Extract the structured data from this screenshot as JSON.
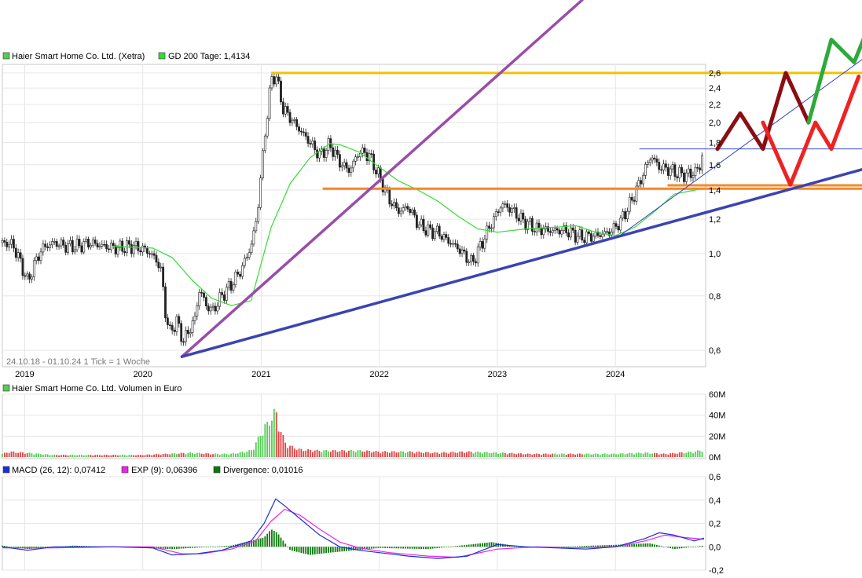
{
  "colors": {
    "price": "#222222",
    "gd200": "#33dd33",
    "yellow": "#f2c200",
    "orange": "#f28a2a",
    "purple": "#9a4da8",
    "blue": "#3b44b0",
    "thinblue": "#3344cc",
    "darkred": "#8b0e12",
    "red": "#ee2222",
    "green": "#2daa3a",
    "vol_up": "#55cc55",
    "vol_down": "#dd4444",
    "macd": "#1a2fd6",
    "exp": "#ee22ee",
    "div": "#0a7a0a",
    "grid": "#e6e6e6"
  },
  "legend": {
    "price": "Haier Smart Home Co. Ltd. (Xetra)",
    "gd200": "GD 200 Tage: 1,4134",
    "volume": "Haier Smart Home Co. Ltd. Volumen in Euro",
    "macd": "MACD (26, 12): 0,07412",
    "exp": "EXP (9): 0,06396",
    "divergence": "Divergence: 0,01016"
  },
  "info": "24.10.18 - 01.10.24   1 Tick = 1 Woche",
  "chart_data": [
    {
      "type": "line",
      "title": "",
      "x_ticks": [
        "2019",
        "2020",
        "2021",
        "2022",
        "2023",
        "2024"
      ],
      "y_scale": "log",
      "ylim": [
        0.55,
        2.72
      ],
      "y_ticks": [
        "0,6",
        "0,8",
        "1,0",
        "1,2",
        "1,4",
        "1,6",
        "1,8",
        "2,0",
        "2,2",
        "2,4",
        "2,6"
      ],
      "x_range": [
        "2018-10-24",
        "2024-10-01"
      ],
      "series": [
        {
          "name": "Haier Smart Home Co. Ltd. (Xetra)",
          "points": [
            [
              "2018-10-24",
              1.06
            ],
            [
              "2018-11-25",
              1.05
            ],
            [
              "2018-12-20",
              0.95
            ],
            [
              "2019-01-10",
              0.86
            ],
            [
              "2019-02-01",
              0.95
            ],
            [
              "2019-02-25",
              1.03
            ],
            [
              "2019-04-01",
              1.06
            ],
            [
              "2019-05-10",
              1.04
            ],
            [
              "2019-06-15",
              1.04
            ],
            [
              "2019-07-20",
              1.06
            ],
            [
              "2019-09-01",
              1.04
            ],
            [
              "2019-10-15",
              1.03
            ],
            [
              "2019-12-01",
              1.04
            ],
            [
              "2020-01-10",
              1.02
            ],
            [
              "2020-02-01",
              0.99
            ],
            [
              "2020-02-25",
              0.93
            ],
            [
              "2020-03-12",
              0.72
            ],
            [
              "2020-03-25",
              0.66
            ],
            [
              "2020-04-15",
              0.7
            ],
            [
              "2020-05-05",
              0.63
            ],
            [
              "2020-05-25",
              0.67
            ],
            [
              "2020-06-10",
              0.71
            ],
            [
              "2020-06-25",
              0.83
            ],
            [
              "2020-07-15",
              0.76
            ],
            [
              "2020-08-05",
              0.74
            ],
            [
              "2020-09-01",
              0.8
            ],
            [
              "2020-10-01",
              0.85
            ],
            [
              "2020-11-01",
              0.92
            ],
            [
              "2020-12-01",
              1.04
            ],
            [
              "2020-12-20",
              1.22
            ],
            [
              "2021-01-05",
              1.65
            ],
            [
              "2021-01-20",
              2.1
            ],
            [
              "2021-02-01",
              2.5
            ],
            [
              "2021-02-15",
              2.58
            ],
            [
              "2021-02-25",
              2.38
            ],
            [
              "2021-03-10",
              2.15
            ],
            [
              "2021-04-01",
              2.05
            ],
            [
              "2021-05-01",
              1.92
            ],
            [
              "2021-06-01",
              1.8
            ],
            [
              "2021-07-01",
              1.68
            ],
            [
              "2021-08-01",
              1.78
            ],
            [
              "2021-09-01",
              1.62
            ],
            [
              "2021-10-01",
              1.55
            ],
            [
              "2021-11-01",
              1.72
            ],
            [
              "2021-12-01",
              1.68
            ],
            [
              "2022-01-01",
              1.5
            ],
            [
              "2022-02-01",
              1.33
            ],
            [
              "2022-03-01",
              1.25
            ],
            [
              "2022-04-01",
              1.28
            ],
            [
              "2022-05-01",
              1.17
            ],
            [
              "2022-06-01",
              1.13
            ],
            [
              "2022-07-01",
              1.12
            ],
            [
              "2022-08-01",
              1.07
            ],
            [
              "2022-09-01",
              1.03
            ],
            [
              "2022-10-15",
              0.95
            ],
            [
              "2022-11-15",
              1.06
            ],
            [
              "2022-12-15",
              1.18
            ],
            [
              "2023-01-15",
              1.3
            ],
            [
              "2023-02-15",
              1.26
            ],
            [
              "2023-03-15",
              1.2
            ],
            [
              "2023-05-01",
              1.14
            ],
            [
              "2023-06-15",
              1.13
            ],
            [
              "2023-08-01",
              1.13
            ],
            [
              "2023-09-15",
              1.09
            ],
            [
              "2023-11-01",
              1.1
            ],
            [
              "2023-12-15",
              1.12
            ],
            [
              "2024-01-15",
              1.18
            ],
            [
              "2024-02-15",
              1.3
            ],
            [
              "2024-03-15",
              1.45
            ],
            [
              "2024-04-20",
              1.68
            ],
            [
              "2024-05-15",
              1.58
            ],
            [
              "2024-06-15",
              1.56
            ],
            [
              "2024-07-20",
              1.52
            ],
            [
              "2024-08-20",
              1.52
            ],
            [
              "2024-09-20",
              1.58
            ],
            [
              "2024-10-01",
              1.82
            ]
          ]
        },
        {
          "name": "GD 200 Tage",
          "points": [
            [
              "2019-10-01",
              1.04
            ],
            [
              "2020-02-01",
              1.03
            ],
            [
              "2020-04-01",
              0.98
            ],
            [
              "2020-06-01",
              0.87
            ],
            [
              "2020-08-01",
              0.79
            ],
            [
              "2020-10-01",
              0.76
            ],
            [
              "2020-12-01",
              0.78
            ],
            [
              "2021-01-01",
              0.95
            ],
            [
              "2021-02-01",
              1.15
            ],
            [
              "2021-04-01",
              1.45
            ],
            [
              "2021-06-01",
              1.66
            ],
            [
              "2021-08-01",
              1.79
            ],
            [
              "2021-09-01",
              1.78
            ],
            [
              "2021-11-01",
              1.71
            ],
            [
              "2022-01-01",
              1.58
            ],
            [
              "2022-03-01",
              1.47
            ],
            [
              "2022-05-01",
              1.4
            ],
            [
              "2022-07-01",
              1.32
            ],
            [
              "2022-09-01",
              1.22
            ],
            [
              "2022-11-01",
              1.14
            ],
            [
              "2023-01-01",
              1.12
            ],
            [
              "2023-04-01",
              1.14
            ],
            [
              "2023-07-01",
              1.15
            ],
            [
              "2023-09-01",
              1.16
            ],
            [
              "2023-11-01",
              1.12
            ],
            [
              "2024-01-01",
              1.1
            ],
            [
              "2024-03-01",
              1.15
            ],
            [
              "2024-05-01",
              1.25
            ],
            [
              "2024-07-01",
              1.37
            ],
            [
              "2024-10-01",
              1.4134
            ]
          ]
        }
      ],
      "annotations": {
        "hlines": [
          {
            "color": "yellow",
            "y": 2.6,
            "from": "2021-02-01",
            "to": "right"
          },
          {
            "color": "orange",
            "y": 1.41,
            "from": "2021-07-10",
            "to": "right"
          },
          {
            "color": "orange",
            "y": 1.435,
            "from": "2024-06-10",
            "to": "right"
          },
          {
            "color": "thinblue",
            "y": 1.74,
            "from": "2024-03-15",
            "to": "right"
          }
        ],
        "trendlines": [
          {
            "color": "purple",
            "from": [
              "2020-05-01",
              0.58
            ],
            "to": [
              "2022-06-01",
              1.85
            ]
          },
          {
            "color": "blue",
            "from": [
              "2020-05-01",
              0.58
            ],
            "to": [
              "2024-10-01",
              1.24
            ]
          },
          {
            "color": "thinblue",
            "from": [
              "2024-01-15",
              1.1
            ],
            "to": [
              "2024-10-01",
              1.52
            ]
          }
        ],
        "zigzags": [
          {
            "color": "darkred",
            "points": [
              [
                0,
                1.74
              ],
              [
                1,
                2.1
              ],
              [
                2,
                1.74
              ],
              [
                3,
                2.6
              ],
              [
                4,
                2.0
              ]
            ]
          },
          {
            "color": "green",
            "points": [
              [
                4,
                2.0
              ],
              [
                5,
                3.1
              ],
              [
                6,
                2.75
              ],
              [
                7,
                3.7
              ]
            ]
          },
          {
            "color": "red",
            "points": [
              [
                2,
                2.0
              ],
              [
                3.2,
                1.44
              ],
              [
                4.3,
                2.0
              ],
              [
                5,
                1.74
              ],
              [
                6.2,
                2.55
              ]
            ]
          }
        ]
      }
    },
    {
      "type": "bar",
      "title": "Haier Smart Home Co. Ltd. Volumen in Euro",
      "y_ticks": [
        "0M",
        "20M",
        "40M",
        "60M"
      ],
      "ylim": [
        0,
        60
      ],
      "unit": "M EUR",
      "points": [
        [
          "2018-10-24",
          3
        ],
        [
          "2018-11-15",
          5
        ],
        [
          "2019-01-01",
          4
        ],
        [
          "2019-04-01",
          2
        ],
        [
          "2019-07-01",
          2
        ],
        [
          "2019-10-01",
          2
        ],
        [
          "2020-01-01",
          2
        ],
        [
          "2020-03-15",
          3
        ],
        [
          "2020-06-01",
          4
        ],
        [
          "2020-08-01",
          3
        ],
        [
          "2020-10-01",
          3
        ],
        [
          "2020-12-01",
          6
        ],
        [
          "2020-12-25",
          18
        ],
        [
          "2021-01-10",
          28
        ],
        [
          "2021-01-20",
          30
        ],
        [
          "2021-02-01",
          38
        ],
        [
          "2021-02-15",
          42
        ],
        [
          "2021-03-01",
          26
        ],
        [
          "2021-03-15",
          14
        ],
        [
          "2021-04-01",
          10
        ],
        [
          "2021-05-01",
          7
        ],
        [
          "2021-07-01",
          6
        ],
        [
          "2021-09-01",
          6
        ],
        [
          "2021-11-01",
          6
        ],
        [
          "2022-01-01",
          5
        ],
        [
          "2022-04-01",
          5
        ],
        [
          "2022-07-01",
          4
        ],
        [
          "2022-10-01",
          5
        ],
        [
          "2023-01-01",
          4
        ],
        [
          "2023-04-01",
          3
        ],
        [
          "2023-07-01",
          3
        ],
        [
          "2023-10-01",
          3
        ],
        [
          "2024-01-01",
          3
        ],
        [
          "2024-04-01",
          4
        ],
        [
          "2024-06-01",
          3
        ],
        [
          "2024-09-01",
          5
        ],
        [
          "2024-10-01",
          7
        ]
      ]
    },
    {
      "type": "line",
      "title": "MACD",
      "y_ticks": [
        "-0,2",
        "0,0",
        "0,2",
        "0,4",
        "0,6"
      ],
      "ylim": [
        -0.2,
        0.6
      ],
      "macd": [
        [
          "2018-10-24",
          0.0
        ],
        [
          "2019-01-10",
          -0.03
        ],
        [
          "2019-04-01",
          0.0
        ],
        [
          "2019-10-01",
          0.0
        ],
        [
          "2020-02-01",
          -0.01
        ],
        [
          "2020-04-01",
          -0.07
        ],
        [
          "2020-06-15",
          -0.06
        ],
        [
          "2020-09-01",
          -0.03
        ],
        [
          "2020-12-01",
          0.05
        ],
        [
          "2021-01-10",
          0.2
        ],
        [
          "2021-02-15",
          0.41
        ],
        [
          "2021-03-15",
          0.35
        ],
        [
          "2021-05-01",
          0.24
        ],
        [
          "2021-07-01",
          0.1
        ],
        [
          "2021-09-01",
          0.0
        ],
        [
          "2021-11-01",
          -0.03
        ],
        [
          "2022-01-01",
          -0.05
        ],
        [
          "2022-04-01",
          -0.08
        ],
        [
          "2022-07-01",
          -0.1
        ],
        [
          "2022-10-01",
          -0.08
        ],
        [
          "2023-01-01",
          0.02
        ],
        [
          "2023-04-01",
          0.0
        ],
        [
          "2023-07-01",
          -0.01
        ],
        [
          "2023-10-01",
          -0.02
        ],
        [
          "2024-01-01",
          0.0
        ],
        [
          "2024-04-01",
          0.07
        ],
        [
          "2024-05-15",
          0.12
        ],
        [
          "2024-07-01",
          0.1
        ],
        [
          "2024-09-01",
          0.05
        ],
        [
          "2024-10-01",
          0.07412
        ]
      ],
      "exp": [
        [
          "2018-10-24",
          -0.01
        ],
        [
          "2019-04-01",
          -0.01
        ],
        [
          "2019-10-01",
          0.0
        ],
        [
          "2020-02-01",
          0.0
        ],
        [
          "2020-05-01",
          -0.06
        ],
        [
          "2020-07-01",
          -0.06
        ],
        [
          "2020-10-01",
          -0.02
        ],
        [
          "2020-12-15",
          0.05
        ],
        [
          "2021-02-01",
          0.22
        ],
        [
          "2021-03-15",
          0.32
        ],
        [
          "2021-05-01",
          0.27
        ],
        [
          "2021-07-01",
          0.15
        ],
        [
          "2021-09-01",
          0.04
        ],
        [
          "2021-11-01",
          -0.01
        ],
        [
          "2022-02-01",
          -0.05
        ],
        [
          "2022-06-01",
          -0.08
        ],
        [
          "2022-09-01",
          -0.09
        ],
        [
          "2023-01-01",
          -0.02
        ],
        [
          "2023-05-01",
          0.0
        ],
        [
          "2023-09-01",
          -0.01
        ],
        [
          "2024-01-01",
          0.0
        ],
        [
          "2024-04-01",
          0.05
        ],
        [
          "2024-06-01",
          0.1
        ],
        [
          "2024-08-01",
          0.08
        ],
        [
          "2024-10-01",
          0.06396
        ]
      ],
      "divergence": [
        [
          "2018-10-24",
          0.01
        ],
        [
          "2019-01-10",
          -0.02
        ],
        [
          "2019-06-01",
          0.01
        ],
        [
          "2020-04-01",
          -0.02
        ],
        [
          "2020-10-01",
          0.01
        ],
        [
          "2021-01-10",
          0.08
        ],
        [
          "2021-02-01",
          0.15
        ],
        [
          "2021-02-20",
          0.12
        ],
        [
          "2021-04-01",
          -0.03
        ],
        [
          "2021-06-01",
          -0.07
        ],
        [
          "2021-08-01",
          -0.05
        ],
        [
          "2022-01-01",
          -0.01
        ],
        [
          "2022-06-01",
          -0.02
        ],
        [
          "2022-12-15",
          0.04
        ],
        [
          "2023-04-01",
          -0.01
        ],
        [
          "2024-02-01",
          0.02
        ],
        [
          "2024-04-15",
          0.03
        ],
        [
          "2024-07-01",
          -0.02
        ],
        [
          "2024-10-01",
          0.01016
        ]
      ]
    }
  ]
}
